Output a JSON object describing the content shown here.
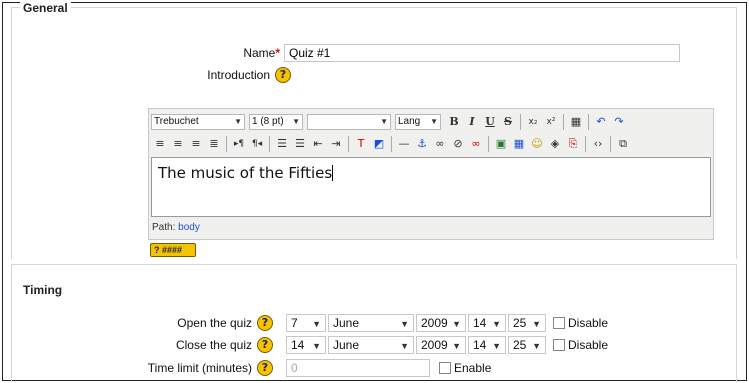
{
  "sections": {
    "general": "General",
    "timing": "Timing"
  },
  "name_field": {
    "label": "Name",
    "required_mark": "*",
    "value": "Quiz #1"
  },
  "introduction": {
    "label": "Introduction"
  },
  "editor": {
    "font_family": "Trebuchet",
    "font_size": "1 (8 pt)",
    "format": "",
    "lang": "Lang",
    "content": "The music of the Fifties",
    "path_label": "Path:",
    "path_value": "body"
  },
  "timing": {
    "open": {
      "label": "Open the quiz",
      "day": "7",
      "month": "June",
      "year": "2009",
      "hour": "14",
      "minute": "25",
      "disable_label": "Disable"
    },
    "close": {
      "label": "Close the quiz",
      "day": "14",
      "month": "June",
      "year": "2009",
      "hour": "14",
      "minute": "25",
      "disable_label": "Disable"
    },
    "time_limit": {
      "label": "Time limit (minutes)",
      "value": "0",
      "enable_label": "Enable"
    }
  },
  "icons": {
    "help": "help-icon",
    "help_symbol": "?"
  }
}
